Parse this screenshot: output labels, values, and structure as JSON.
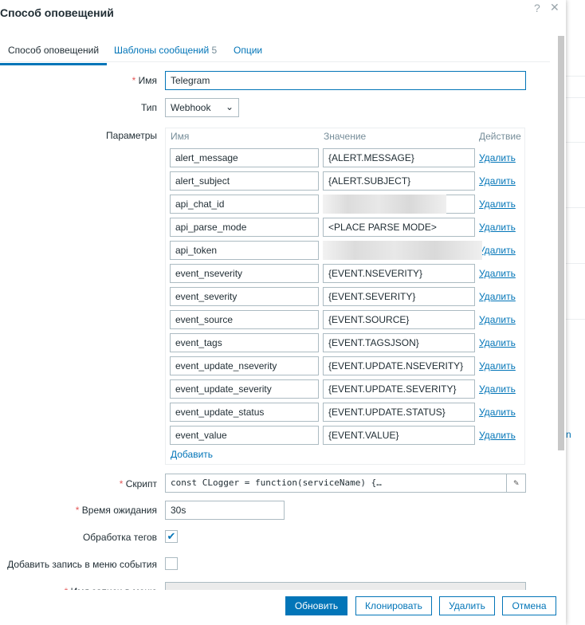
{
  "dialog": {
    "title": "Способ оповещений",
    "help": "?",
    "close": "✕"
  },
  "tabs": [
    {
      "label": "Способ оповещений"
    },
    {
      "label": "Шаблоны сообщений",
      "count": "5"
    },
    {
      "label": "Опции"
    }
  ],
  "form": {
    "name_label": "Имя",
    "name_value": "Telegram",
    "type_label": "Тип",
    "type_value": "Webhook",
    "params_label": "Параметры",
    "params_headers": {
      "name": "Имя",
      "value": "Значение",
      "action": "Действие"
    },
    "params": [
      {
        "name": "alert_message",
        "value": "{ALERT.MESSAGE}"
      },
      {
        "name": "alert_subject",
        "value": "{ALERT.SUBJECT}"
      },
      {
        "name": "api_chat_id",
        "value": ""
      },
      {
        "name": "api_parse_mode",
        "value": "<PLACE PARSE MODE>"
      },
      {
        "name": "api_token",
        "value": ""
      },
      {
        "name": "event_nseverity",
        "value": "{EVENT.NSEVERITY}"
      },
      {
        "name": "event_severity",
        "value": "{EVENT.SEVERITY}"
      },
      {
        "name": "event_source",
        "value": "{EVENT.SOURCE}"
      },
      {
        "name": "event_tags",
        "value": "{EVENT.TAGSJSON}"
      },
      {
        "name": "event_update_nseverity",
        "value": "{EVENT.UPDATE.NSEVERITY}"
      },
      {
        "name": "event_update_severity",
        "value": "{EVENT.UPDATE.SEVERITY}"
      },
      {
        "name": "event_update_status",
        "value": "{EVENT.UPDATE.STATUS}"
      },
      {
        "name": "event_value",
        "value": "{EVENT.VALUE}"
      }
    ],
    "delete_label": "Удалить",
    "add_label": "Добавить",
    "script_label": "Скрипт",
    "script_value": "const CLogger = function(serviceName) {…",
    "timeout_label": "Время ожидания",
    "timeout_value": "30s",
    "tags_label": "Обработка тегов",
    "tags_checked": true,
    "menu_label": "Добавить запись в меню события",
    "menu_checked": false,
    "menu_name_label": "Имя записи в меню"
  },
  "buttons": {
    "update": "Обновить",
    "clone": "Клонировать",
    "delete": "Удалить",
    "cancel": "Отмена"
  },
  "background": {
    "partial_text": "n"
  }
}
